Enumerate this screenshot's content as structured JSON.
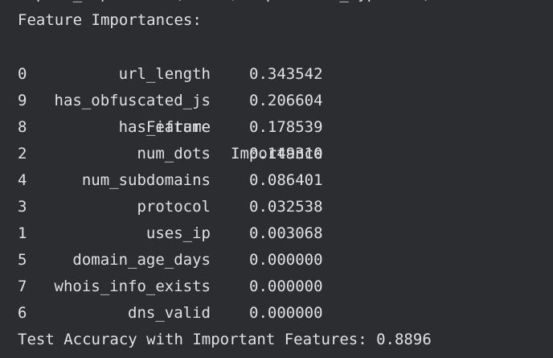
{
  "console": {
    "cutoff_text": "m.plot_importance(model, importance_type=...)",
    "title": "Feature Importances:",
    "header": {
      "feature": "Feature",
      "importance": "Importance"
    },
    "rows": [
      {
        "index": "0",
        "feature": "url_length",
        "importance": "0.343542"
      },
      {
        "index": "9",
        "feature": "has_obfuscated_js",
        "importance": "0.206604"
      },
      {
        "index": "8",
        "feature": "has_iframe",
        "importance": "0.178539"
      },
      {
        "index": "2",
        "feature": "num_dots",
        "importance": "0.149310"
      },
      {
        "index": "4",
        "feature": "num_subdomains",
        "importance": "0.086401"
      },
      {
        "index": "3",
        "feature": "protocol",
        "importance": "0.032538"
      },
      {
        "index": "1",
        "feature": "uses_ip",
        "importance": "0.003068"
      },
      {
        "index": "5",
        "feature": "domain_age_days",
        "importance": "0.000000"
      },
      {
        "index": "7",
        "feature": "whois_info_exists",
        "importance": "0.000000"
      },
      {
        "index": "6",
        "feature": "dns_valid",
        "importance": "0.000000"
      }
    ],
    "accuracy_line": "Test Accuracy with Important Features: 0.8896"
  },
  "colors": {
    "background": "#2b2d30",
    "text": "#dfe1e5"
  }
}
